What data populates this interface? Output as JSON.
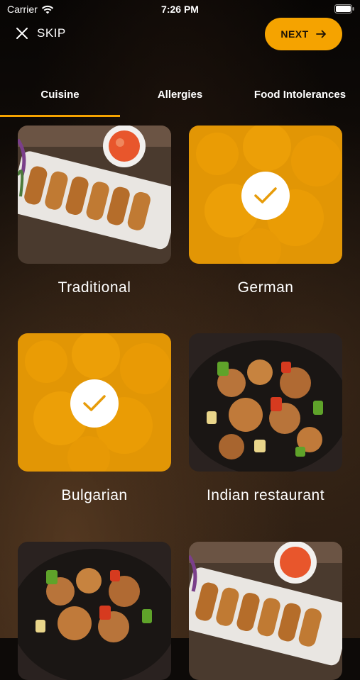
{
  "status_bar": {
    "carrier": "Carrier",
    "time": "7:26 PM"
  },
  "header": {
    "skip_label": "SKIP",
    "next_label": "NEXT"
  },
  "tabs": [
    {
      "label": "Cuisine",
      "active": true
    },
    {
      "label": "Allergies",
      "active": false
    },
    {
      "label": "Food Intolerances",
      "active": false
    }
  ],
  "cuisines": [
    {
      "label": "Traditional",
      "selected": false,
      "image": "spring-rolls"
    },
    {
      "label": "German",
      "selected": true,
      "image": "fried-dumplings"
    },
    {
      "label": "Bulgarian",
      "selected": true,
      "image": "fried-dumplings"
    },
    {
      "label": "Indian restaurant",
      "selected": false,
      "image": "sweet-sour-chicken"
    },
    {
      "label": "",
      "selected": false,
      "image": "sweet-sour-chicken"
    },
    {
      "label": "",
      "selected": false,
      "image": "spring-rolls"
    }
  ],
  "colors": {
    "accent": "#f5a300",
    "background": "#0d0a08",
    "text": "#ffffff"
  }
}
